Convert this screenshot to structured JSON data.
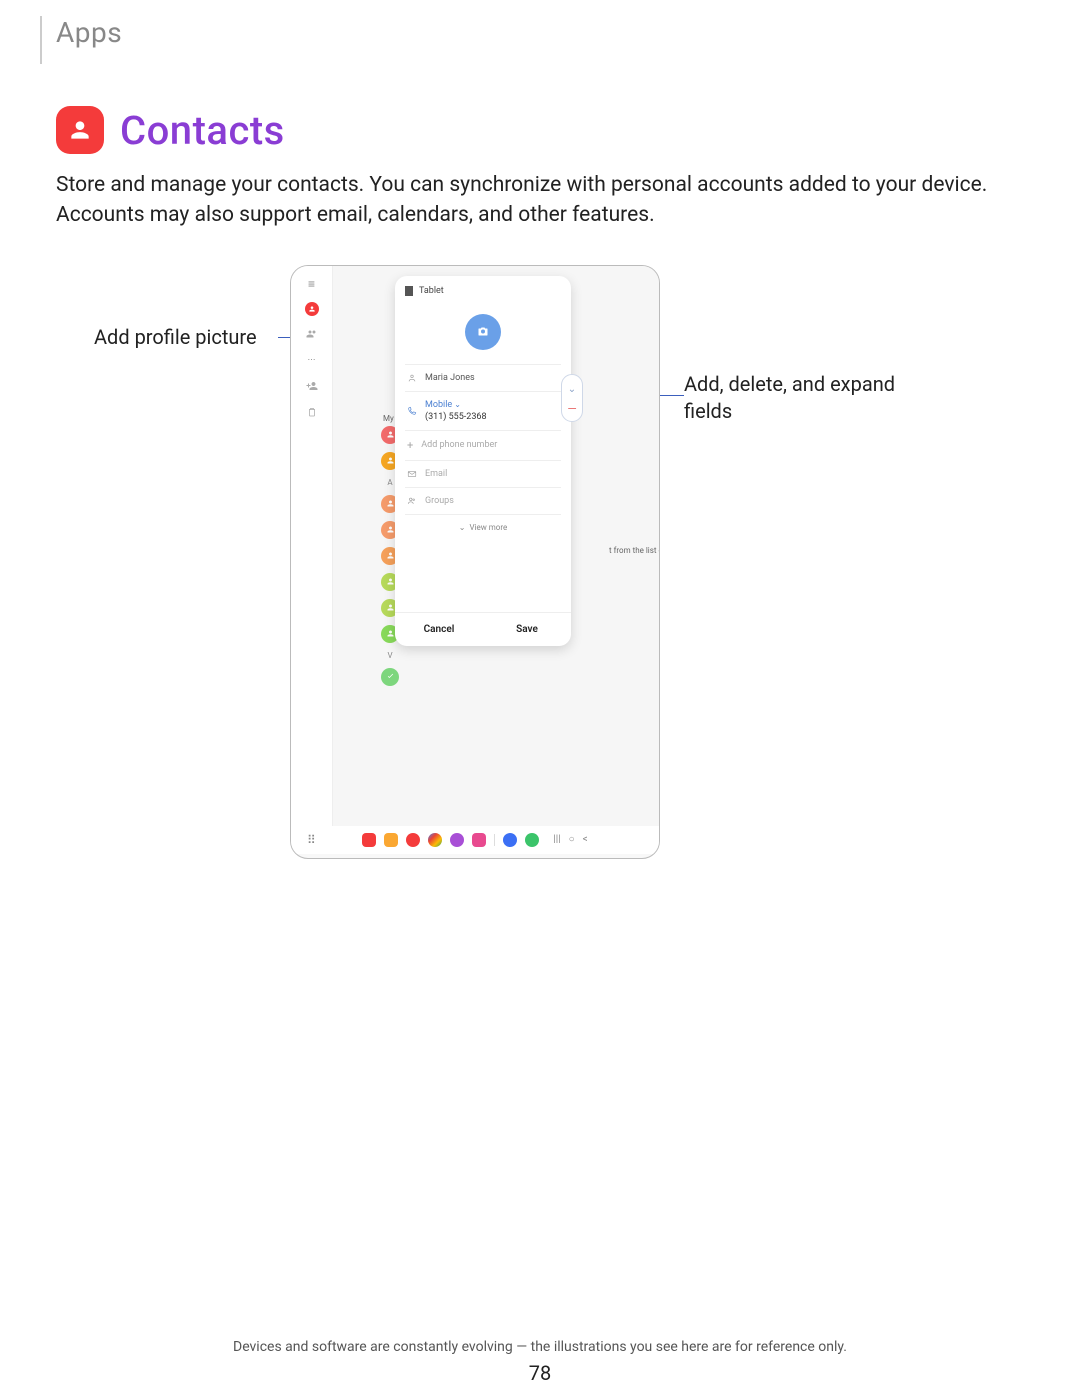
{
  "breadcrumb": "Apps",
  "title": "Contacts",
  "description": "Store and manage your contacts. You can synchronize with personal accounts added to your device. Accounts may also support email, calendars, and other features.",
  "callouts": {
    "left": "Add profile picture",
    "right": "Add, delete, and expand fields"
  },
  "card": {
    "storage": "Tablet",
    "name": "Maria Jones",
    "phone_type": "Mobile",
    "phone_number": "(311) 555-2368",
    "add_phone": "Add phone number",
    "email": "Email",
    "groups": "Groups",
    "view_more": "View more",
    "cancel": "Cancel",
    "save": "Save"
  },
  "sidebar": {
    "my_profile": "My profile"
  },
  "background_hint": "t from the list on left.",
  "footer": "Devices and software are constantly evolving — the illustrations you see here are for reference only.",
  "page": "78",
  "contact_colors": [
    "#f26b6b",
    "#f5a623",
    "#f59b6b",
    "#f59b6b",
    "#f5a05a",
    "#b6d95a",
    "#b6d95a",
    "#88d95a"
  ],
  "letter_marker": "V"
}
